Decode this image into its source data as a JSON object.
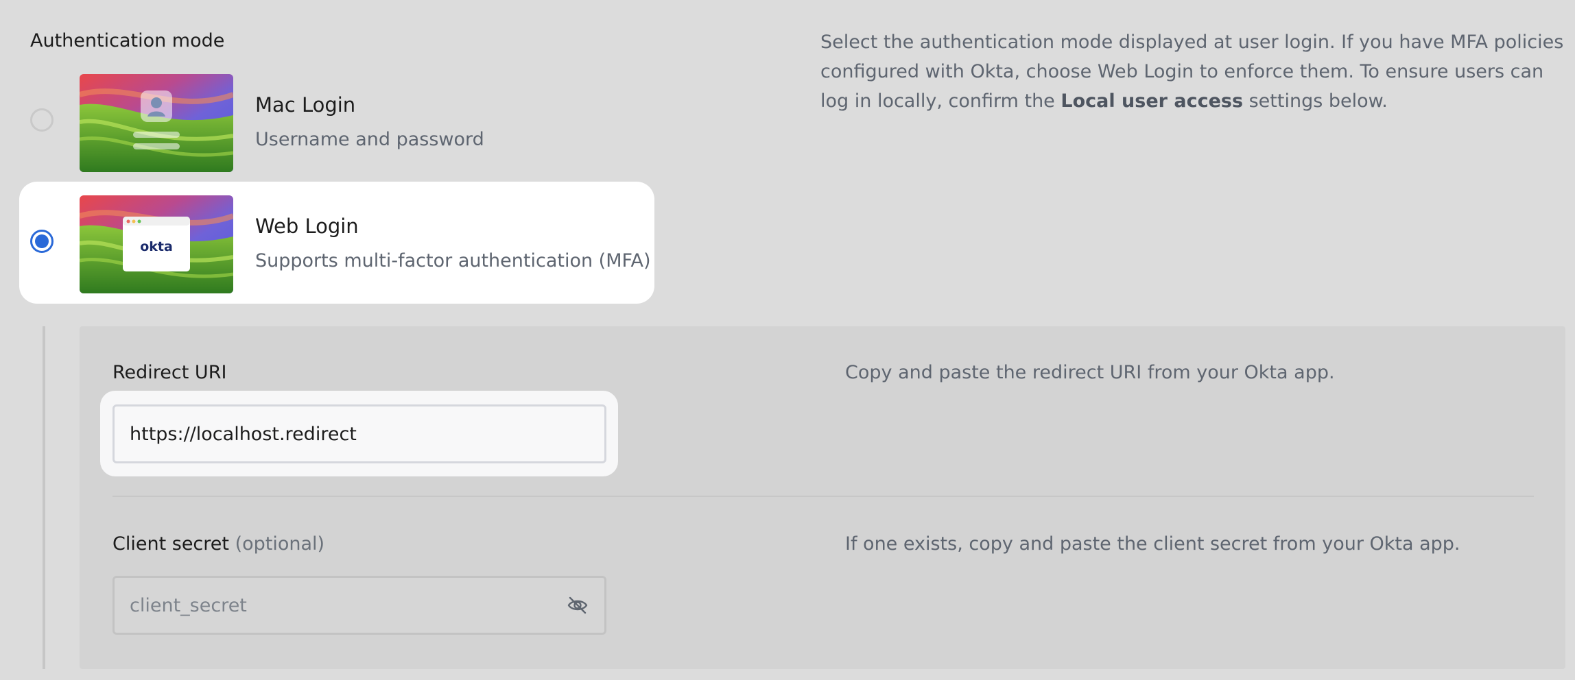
{
  "auth_mode": {
    "title": "Authentication mode",
    "description_before": "Select the authentication mode displayed at user login. If you have MFA policies configured with Okta, choose Web Login to enforce them. To ensure users can log in locally, confirm the ",
    "description_bold": "Local user access",
    "description_after": " settings below.",
    "options": [
      {
        "title": "Mac Login",
        "subtitle": "Username and password",
        "selected": false
      },
      {
        "title": "Web Login",
        "subtitle": "Supports multi-factor authentication (MFA)",
        "selected": true,
        "logo_text": "okta"
      }
    ]
  },
  "redirect_uri": {
    "label": "Redirect URI",
    "value": "https://localhost.redirect",
    "help": "Copy and paste the redirect URI from your Okta app."
  },
  "client_secret": {
    "label": "Client secret",
    "optional": "(optional)",
    "placeholder": "client_secret",
    "help": "If one exists, copy and paste the client secret from your Okta app."
  },
  "icons": {
    "visibility_toggle": "eye-off-icon"
  },
  "colors": {
    "accent": "#2a69d8",
    "background": "#dcdcdc",
    "panel": "#d3d3d3"
  }
}
